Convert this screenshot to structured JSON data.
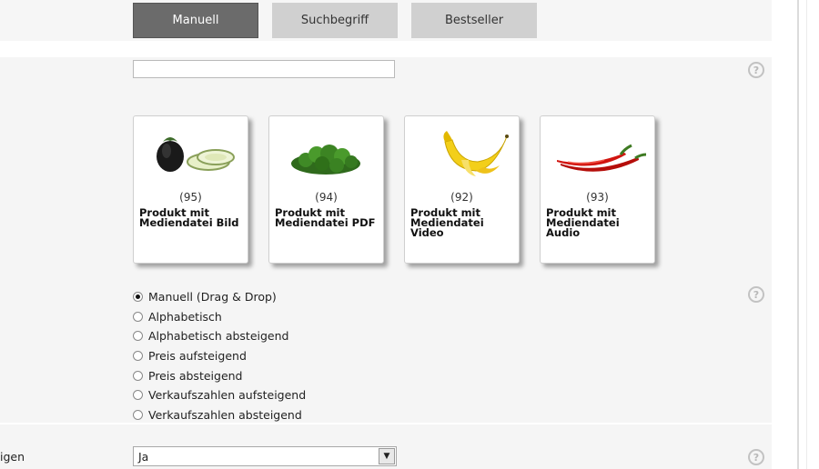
{
  "tabs": [
    {
      "label": "Manuell",
      "active": true
    },
    {
      "label": "Suchbegriff",
      "active": false
    },
    {
      "label": "Bestseller",
      "active": false
    }
  ],
  "products": [
    {
      "id": "(95)",
      "name": "Produkt mit Mediendatei Bild",
      "icon": "eggplant-image"
    },
    {
      "id": "(94)",
      "name": "Produkt mit Mediendatei PDF",
      "icon": "parsley-image"
    },
    {
      "id": "(92)",
      "name": "Produkt mit Mediendatei Video",
      "icon": "banana-image"
    },
    {
      "id": "(93)",
      "name": "Produkt mit Mediendatei Audio",
      "icon": "chili-image"
    }
  ],
  "sort_options": [
    {
      "label": "Manuell (Drag & Drop)",
      "checked": true
    },
    {
      "label": "Alphabetisch",
      "checked": false
    },
    {
      "label": "Alphabetisch absteigend",
      "checked": false
    },
    {
      "label": "Preis aufsteigend",
      "checked": false
    },
    {
      "label": "Preis absteigend",
      "checked": false
    },
    {
      "label": "Verkaufszahlen aufsteigend",
      "checked": false
    },
    {
      "label": "Verkaufszahlen absteigend",
      "checked": false
    }
  ],
  "bottom_row": {
    "label": "igen",
    "select_value": "Ja"
  },
  "help_glyph": "?",
  "colors": {
    "tab_active": "#6b6b6b",
    "tab_inactive": "#d0d0d0",
    "panel_bg": "#f5f5f5"
  }
}
